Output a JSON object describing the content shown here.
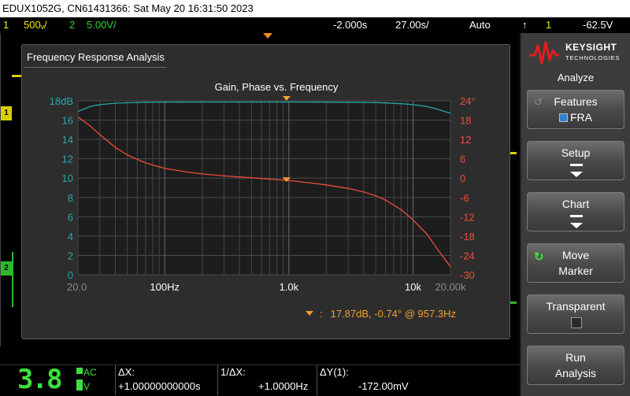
{
  "titlebar": {
    "text": "EDUX1052G, CN61431366: Sat May 20 16:31:50 2023"
  },
  "statusbar": {
    "ch1_num": "1",
    "ch1_scale": "500ₘ/",
    "ch2_num": "2",
    "ch2_scale": "5.00V/",
    "time_offset": "-2.000ₛ",
    "time_scale": "27.00ₛ/",
    "mode": "Auto",
    "trig_num": "1",
    "trig_level": "-62.5ₘ",
    "ch1_scale_disp": "500ᵥ/",
    "time_offset_disp": "-2.000s",
    "time_scale_disp": "27.00s/",
    "trig_level_disp": "-62.5V"
  },
  "fra": {
    "title": "Frequency Response Analysis",
    "marker_readout": "17.87dB, -0.74° @ 957.3Hz"
  },
  "chart_data": {
    "type": "line",
    "title": "Gain, Phase vs. Frequency",
    "x_scale": "log",
    "x_ticks": [
      "20.0",
      "100Hz",
      "1.0k",
      "10k",
      "20.00k"
    ],
    "x_tick_values": [
      20,
      100,
      1000,
      10000,
      20000
    ],
    "xlim": [
      20,
      20000
    ],
    "y_left": {
      "ticks": [
        "18dB",
        "16",
        "14",
        "12",
        "10",
        "8",
        "6",
        "4",
        "2",
        "0"
      ],
      "ylim": [
        0,
        18
      ],
      "color": "#2aa6a6"
    },
    "y_right": {
      "ticks": [
        "24°",
        "18",
        "12",
        "6",
        "0",
        "-6",
        "-12",
        "-18",
        "-24",
        "-30"
      ],
      "ylim": [
        -30,
        24
      ],
      "color": "#ee4c3c"
    },
    "grid": true,
    "series": [
      {
        "axis": "left",
        "color": "#2aa6a6",
        "x": [
          20,
          25,
          30,
          40,
          50,
          70,
          100,
          200,
          500,
          1000,
          2000,
          5000,
          8000,
          10000,
          13000,
          16000,
          20000
        ],
        "y": [
          16.9,
          17.4,
          17.6,
          17.75,
          17.8,
          17.85,
          17.86,
          17.87,
          17.87,
          17.87,
          17.86,
          17.82,
          17.7,
          17.6,
          17.4,
          17.1,
          16.7
        ]
      },
      {
        "axis": "right",
        "color": "#ee4c3c",
        "x": [
          20,
          25,
          30,
          40,
          50,
          70,
          100,
          150,
          200,
          300,
          500,
          700,
          1000,
          1500,
          2000,
          3000,
          4000,
          5000,
          6000,
          8000,
          10000,
          13000,
          16000,
          20000
        ],
        "y": [
          19,
          16.2,
          13.5,
          9.5,
          7.2,
          4.7,
          3.0,
          1.9,
          1.3,
          0.7,
          0.1,
          -0.3,
          -0.74,
          -1.5,
          -2.1,
          -3.2,
          -4.3,
          -5.5,
          -6.8,
          -9.8,
          -13.0,
          -17.5,
          -22.5,
          -27.5
        ]
      }
    ],
    "marker": {
      "x": 957.3,
      "gain_db": 17.87,
      "phase_deg": -0.74,
      "color": "#f0a030"
    }
  },
  "panel": {
    "logo_line1": "KEYSIGHT",
    "logo_line2": "TECHNOLOGIES",
    "header": "Analyze",
    "features_label": "Features",
    "features_value": "FRA",
    "setup_label": "Setup",
    "chart_label": "Chart",
    "move_label": "Move",
    "marker_label": "Marker",
    "transparent_label": "Transparent",
    "run_label": "Run",
    "analysis_label": "Analysis"
  },
  "bottom": {
    "big_value": "3.8",
    "ac_label": "AC",
    "v_label": "V",
    "dx_label": "ΔX:",
    "dx_value": "+1.00000000000s",
    "inv_dx_label": "1/ΔX:",
    "inv_dx_value": "+1.0000Hz",
    "dy_label": "ΔY(1):",
    "dy_value": "-172.00mV"
  },
  "colors": {
    "ch1": "#f0e800",
    "ch2": "#35d135",
    "gain": "#2aa6a6",
    "phase": "#ee4c3c",
    "marker": "#f0a030"
  }
}
